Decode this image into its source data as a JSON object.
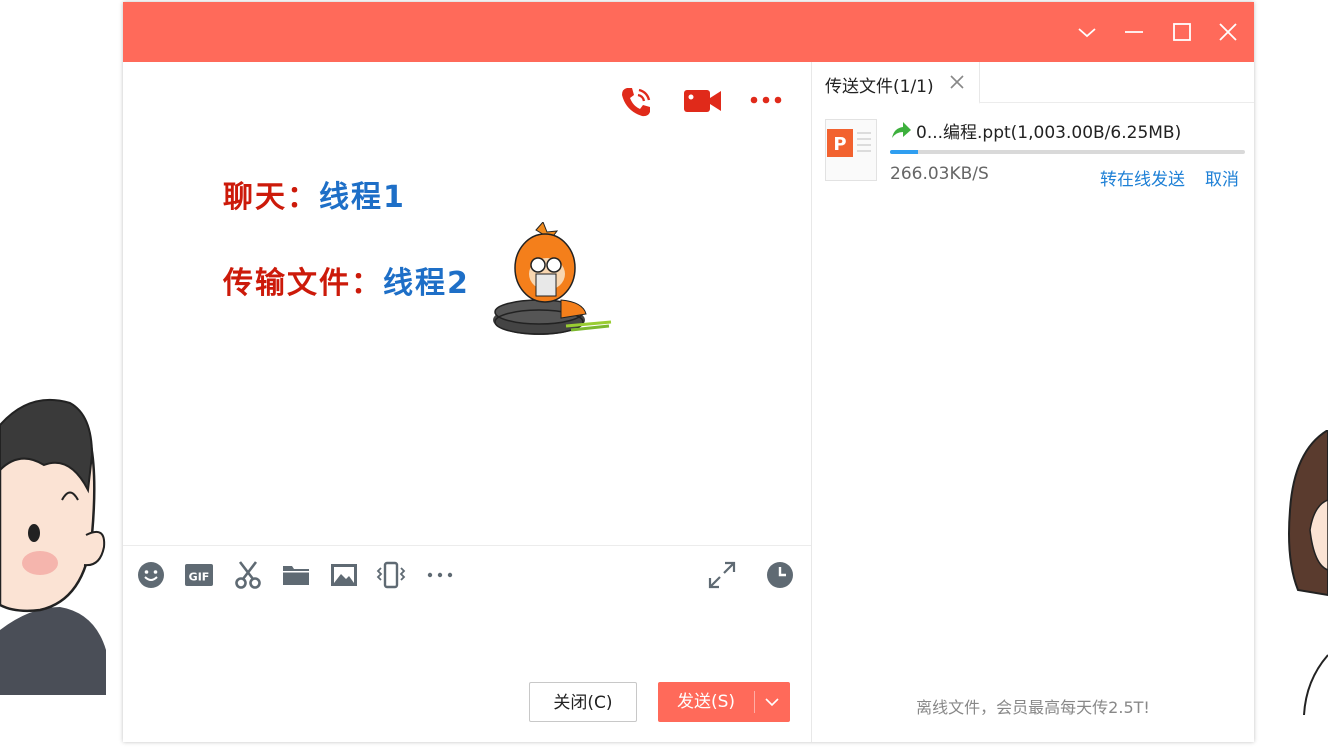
{
  "colors": {
    "titlebar": "#ff6a5a",
    "accent_red": "#e02a1a",
    "message_label": "#cc1a0a",
    "message_value": "#1e6fc7",
    "link": "#1e80d6",
    "progress": "#2f9ef0"
  },
  "titlebar": {
    "controls": [
      "chevron-down-icon",
      "minimize-icon",
      "maximize-icon",
      "close-icon"
    ]
  },
  "chat": {
    "header_icons": [
      "phone-call-icon",
      "video-call-icon",
      "more-icon"
    ],
    "messages": [
      {
        "label": "聊天：",
        "value": "线程1"
      },
      {
        "label": "传输文件：",
        "value": "线程2"
      }
    ],
    "toolbar": [
      "emoji-icon",
      "gif-icon",
      "scissors-icon",
      "folder-icon",
      "image-icon",
      "shake-icon",
      "more-icon",
      "expand-icon",
      "history-clock-icon"
    ],
    "gif_text": "GIF",
    "close_button": "关闭(C)",
    "send_button": "发送(S)"
  },
  "files": {
    "tab_label": "传送文件(1/1)",
    "file_name": "0...编程.ppt(1,003.00B/6.25MB)",
    "file_icon_letter": "P",
    "speed": "266.03KB/S",
    "progress": 0.08,
    "action_offline": "转在线发送",
    "action_cancel": "取消",
    "footer_note": "离线文件，会员最高每天传2.5T!"
  }
}
